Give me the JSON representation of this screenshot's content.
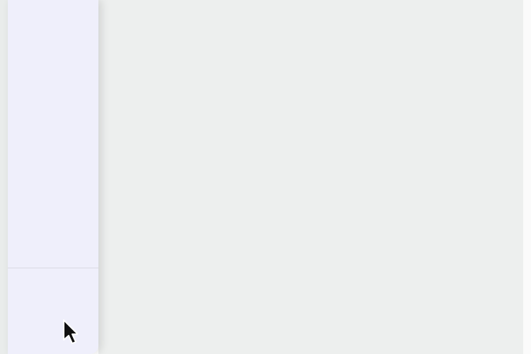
{
  "colors": {
    "left_gutter": "#e9eceb",
    "sidebar_background": "#efeffb",
    "main_background": "#edefee",
    "right_gutter": "#fbfbfb",
    "icon_color": "#15213d"
  },
  "sidebar": {
    "account_button": {
      "icon": "user-gear-icon"
    }
  },
  "cursor": {
    "icon": "mouse-pointer-icon"
  }
}
